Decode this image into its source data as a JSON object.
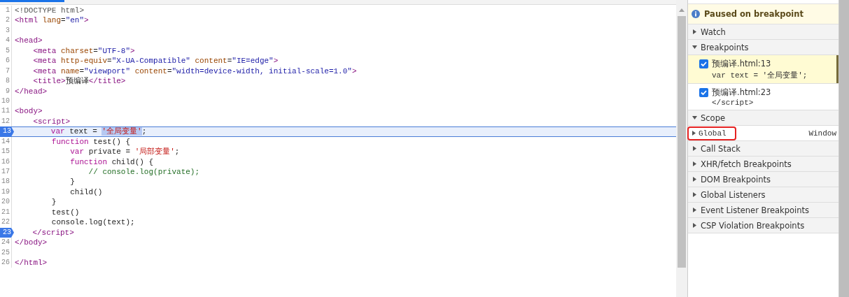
{
  "editor": {
    "lines": [
      {
        "number": "1",
        "breakpoint": false,
        "current": false,
        "tokens": [
          {
            "kind": "d",
            "text": "<!DOCTYPE html>"
          }
        ]
      },
      {
        "number": "2",
        "breakpoint": false,
        "current": false,
        "tokens": [
          {
            "kind": "tag",
            "text": "<html"
          },
          {
            "kind": "attr",
            "text": " lang"
          },
          {
            "kind": "p",
            "text": "="
          },
          {
            "kind": "val",
            "text": "\"en\""
          },
          {
            "kind": "tag",
            "text": ">"
          }
        ]
      },
      {
        "number": "3",
        "breakpoint": false,
        "current": false
      },
      {
        "number": "4",
        "breakpoint": false,
        "current": false,
        "tokens": [
          {
            "kind": "tag",
            "text": "<head>"
          }
        ]
      },
      {
        "number": "5",
        "breakpoint": false,
        "current": false,
        "tokens": [
          {
            "kind": "tag",
            "text": "    <meta"
          },
          {
            "kind": "attr",
            "text": " charset"
          },
          {
            "kind": "p",
            "text": "="
          },
          {
            "kind": "val",
            "text": "\"UTF-8\""
          },
          {
            "kind": "tag",
            "text": ">"
          }
        ]
      },
      {
        "number": "6",
        "breakpoint": false,
        "current": false,
        "tokens": [
          {
            "kind": "tag",
            "text": "    <meta"
          },
          {
            "kind": "attr",
            "text": " http-equiv"
          },
          {
            "kind": "p",
            "text": "="
          },
          {
            "kind": "val",
            "text": "\"X-UA-Compatible\""
          },
          {
            "kind": "attr",
            "text": " content"
          },
          {
            "kind": "p",
            "text": "="
          },
          {
            "kind": "val",
            "text": "\"IE=edge\""
          },
          {
            "kind": "tag",
            "text": ">"
          }
        ]
      },
      {
        "number": "7",
        "breakpoint": false,
        "current": false,
        "tokens": [
          {
            "kind": "tag",
            "text": "    <meta"
          },
          {
            "kind": "attr",
            "text": " name"
          },
          {
            "kind": "p",
            "text": "="
          },
          {
            "kind": "val",
            "text": "\"viewport\""
          },
          {
            "kind": "attr",
            "text": " content"
          },
          {
            "kind": "p",
            "text": "="
          },
          {
            "kind": "val",
            "text": "\"width=device-width, initial-scale=1.0\""
          },
          {
            "kind": "tag",
            "text": ">"
          }
        ]
      },
      {
        "number": "8",
        "breakpoint": false,
        "current": false,
        "tokens": [
          {
            "kind": "tag",
            "text": "    <title>"
          },
          {
            "kind": "p",
            "text": "预编译"
          },
          {
            "kind": "tag",
            "text": "</title>"
          }
        ]
      },
      {
        "number": "9",
        "breakpoint": false,
        "current": false,
        "tokens": [
          {
            "kind": "tag",
            "text": "</head>"
          }
        ]
      },
      {
        "number": "10",
        "breakpoint": false,
        "current": false
      },
      {
        "number": "11",
        "breakpoint": false,
        "current": false,
        "tokens": [
          {
            "kind": "tag",
            "text": "<body>"
          }
        ]
      },
      {
        "number": "12",
        "breakpoint": false,
        "current": false,
        "tokens": [
          {
            "kind": "tag",
            "text": "    <script>"
          }
        ]
      },
      {
        "number": "13",
        "breakpoint": true,
        "current": true,
        "tokens": [
          {
            "kind": "kw",
            "text": "        var"
          },
          {
            "kind": "p",
            "text": " text = "
          },
          {
            "kind": "sel",
            "text": "'全局变量'"
          },
          {
            "kind": "p",
            "text": ";"
          }
        ]
      },
      {
        "number": "14",
        "breakpoint": false,
        "current": false,
        "tokens": [
          {
            "kind": "kw",
            "text": "        function"
          },
          {
            "kind": "p",
            "text": " test() {"
          }
        ]
      },
      {
        "number": "15",
        "breakpoint": false,
        "current": false,
        "tokens": [
          {
            "kind": "kw",
            "text": "            var"
          },
          {
            "kind": "p",
            "text": " private = "
          },
          {
            "kind": "str",
            "text": "'局部变量'"
          },
          {
            "kind": "p",
            "text": ";"
          }
        ]
      },
      {
        "number": "16",
        "breakpoint": false,
        "current": false,
        "tokens": [
          {
            "kind": "kw",
            "text": "            function"
          },
          {
            "kind": "p",
            "text": " child() {"
          }
        ]
      },
      {
        "number": "17",
        "breakpoint": false,
        "current": false,
        "tokens": [
          {
            "kind": "cm",
            "text": "                // console.log(private);"
          }
        ]
      },
      {
        "number": "18",
        "breakpoint": false,
        "current": false,
        "tokens": [
          {
            "kind": "p",
            "text": "            }"
          }
        ]
      },
      {
        "number": "19",
        "breakpoint": false,
        "current": false,
        "tokens": [
          {
            "kind": "p",
            "text": "            child()"
          }
        ]
      },
      {
        "number": "20",
        "breakpoint": false,
        "current": false,
        "tokens": [
          {
            "kind": "p",
            "text": "        }"
          }
        ]
      },
      {
        "number": "21",
        "breakpoint": false,
        "current": false,
        "tokens": [
          {
            "kind": "p",
            "text": "        test()"
          }
        ]
      },
      {
        "number": "22",
        "breakpoint": false,
        "current": false,
        "tokens": [
          {
            "kind": "p",
            "text": "        console.log(text);"
          }
        ]
      },
      {
        "number": "23",
        "breakpoint": true,
        "current": false,
        "tokens": [
          {
            "kind": "tag",
            "text": "    </script>"
          }
        ]
      },
      {
        "number": "24",
        "breakpoint": false,
        "current": false,
        "tokens": [
          {
            "kind": "tag",
            "text": "</body>"
          }
        ]
      },
      {
        "number": "25",
        "breakpoint": false,
        "current": false
      },
      {
        "number": "26",
        "breakpoint": false,
        "current": false,
        "tokens": [
          {
            "kind": "tag",
            "text": "</html>"
          }
        ]
      }
    ]
  },
  "debugger": {
    "status": "Paused on breakpoint",
    "sections": [
      {
        "title": "Watch",
        "expanded": false
      },
      {
        "title": "Breakpoints",
        "expanded": true,
        "breakpoints": [
          {
            "file": "预编译.html:13",
            "code": "var text = '全局变量';",
            "checked": true,
            "active": true
          },
          {
            "file": "预编译.html:23",
            "code": "</script>",
            "checked": true,
            "active": false
          }
        ]
      },
      {
        "title": "Scope",
        "expanded": true,
        "variables": [
          {
            "name": "Global",
            "value": "Window",
            "expanded": false,
            "annotated": true
          }
        ]
      },
      {
        "title": "Call Stack",
        "expanded": false
      },
      {
        "title": "XHR/fetch Breakpoints",
        "expanded": false
      },
      {
        "title": "DOM Breakpoints",
        "expanded": false
      },
      {
        "title": "Global Listeners",
        "expanded": false
      },
      {
        "title": "Event Listener Breakpoints",
        "expanded": false
      },
      {
        "title": "CSP Violation Breakpoints",
        "expanded": false
      }
    ]
  }
}
